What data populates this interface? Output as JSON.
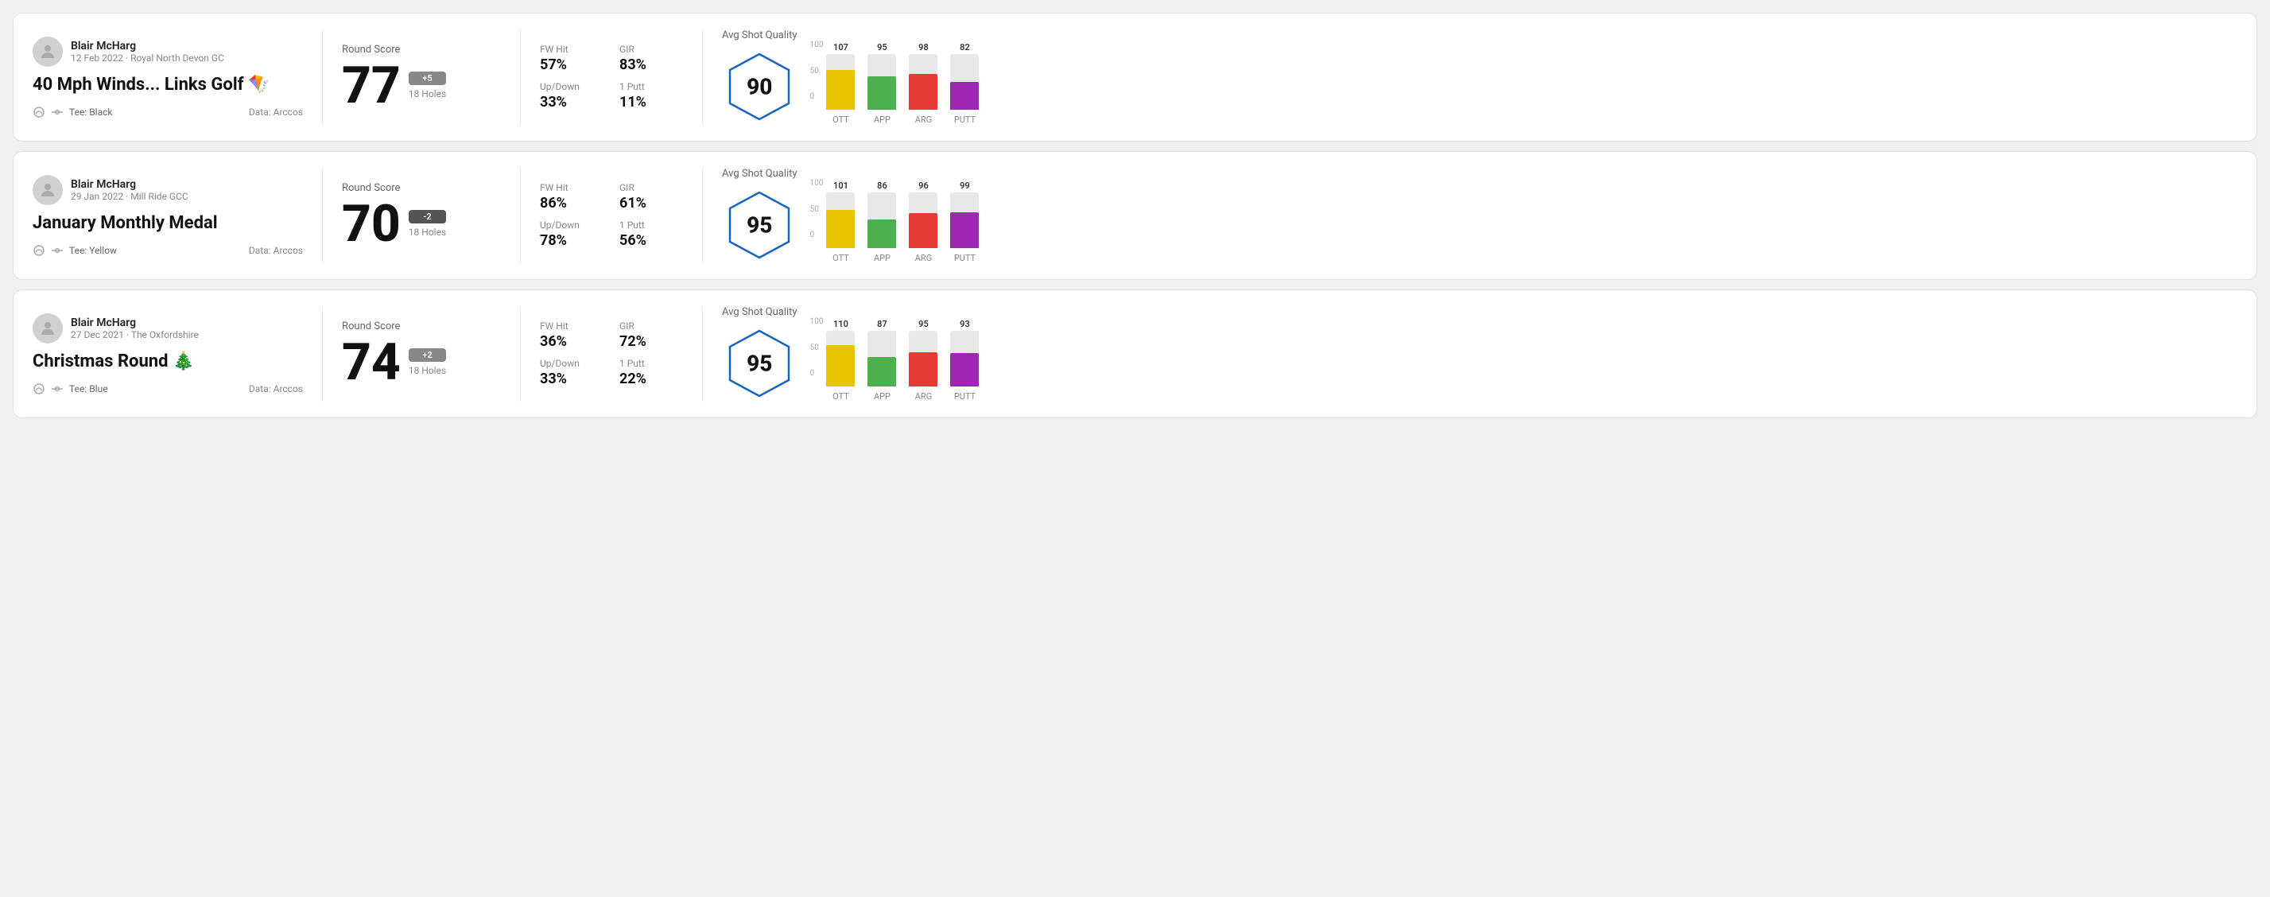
{
  "rounds": [
    {
      "id": "round1",
      "user_name": "Blair McHarg",
      "user_date": "12 Feb 2022 · Royal North Devon GC",
      "round_title": "40 Mph Winds... Links Golf 🪁",
      "tee": "Black",
      "data_source": "Data: Arccos",
      "score": "77",
      "score_diff": "+5",
      "holes": "18 Holes",
      "fw_hit_label": "FW Hit",
      "fw_hit_value": "57%",
      "gir_label": "GIR",
      "gir_value": "83%",
      "updown_label": "Up/Down",
      "updown_value": "33%",
      "oneputt_label": "1 Putt",
      "oneputt_value": "11%",
      "avg_label": "Avg Shot Quality",
      "avg_score": "90",
      "chart": {
        "ott": {
          "label": "OTT",
          "value": 107,
          "color": "#e8c400",
          "bar_pct": 72
        },
        "app": {
          "label": "APP",
          "value": 95,
          "color": "#4caf50",
          "bar_pct": 60
        },
        "arg": {
          "label": "ARG",
          "value": 98,
          "color": "#e53935",
          "bar_pct": 65
        },
        "putt": {
          "label": "PUTT",
          "value": 82,
          "color": "#9c27b0",
          "bar_pct": 50
        }
      }
    },
    {
      "id": "round2",
      "user_name": "Blair McHarg",
      "user_date": "29 Jan 2022 · Mill Ride GCC",
      "round_title": "January Monthly Medal",
      "tee": "Yellow",
      "data_source": "Data: Arccos",
      "score": "70",
      "score_diff": "-2",
      "holes": "18 Holes",
      "fw_hit_label": "FW Hit",
      "fw_hit_value": "86%",
      "gir_label": "GIR",
      "gir_value": "61%",
      "updown_label": "Up/Down",
      "updown_value": "78%",
      "oneputt_label": "1 Putt",
      "oneputt_value": "56%",
      "avg_label": "Avg Shot Quality",
      "avg_score": "95",
      "chart": {
        "ott": {
          "label": "OTT",
          "value": 101,
          "color": "#e8c400",
          "bar_pct": 68
        },
        "app": {
          "label": "APP",
          "value": 86,
          "color": "#4caf50",
          "bar_pct": 52
        },
        "arg": {
          "label": "ARG",
          "value": 96,
          "color": "#e53935",
          "bar_pct": 63
        },
        "putt": {
          "label": "PUTT",
          "value": 99,
          "color": "#9c27b0",
          "bar_pct": 65
        }
      }
    },
    {
      "id": "round3",
      "user_name": "Blair McHarg",
      "user_date": "27 Dec 2021 · The Oxfordshire",
      "round_title": "Christmas Round 🎄",
      "tee": "Blue",
      "data_source": "Data: Arccos",
      "score": "74",
      "score_diff": "+2",
      "holes": "18 Holes",
      "fw_hit_label": "FW Hit",
      "fw_hit_value": "36%",
      "gir_label": "GIR",
      "gir_value": "72%",
      "updown_label": "Up/Down",
      "updown_value": "33%",
      "oneputt_label": "1 Putt",
      "oneputt_value": "22%",
      "avg_label": "Avg Shot Quality",
      "avg_score": "95",
      "chart": {
        "ott": {
          "label": "OTT",
          "value": 110,
          "color": "#e8c400",
          "bar_pct": 74
        },
        "app": {
          "label": "APP",
          "value": 87,
          "color": "#4caf50",
          "bar_pct": 53
        },
        "arg": {
          "label": "ARG",
          "value": 95,
          "color": "#e53935",
          "bar_pct": 62
        },
        "putt": {
          "label": "PUTT",
          "value": 93,
          "color": "#9c27b0",
          "bar_pct": 60
        }
      }
    }
  ],
  "y_axis_labels": [
    "100",
    "50",
    "0"
  ]
}
